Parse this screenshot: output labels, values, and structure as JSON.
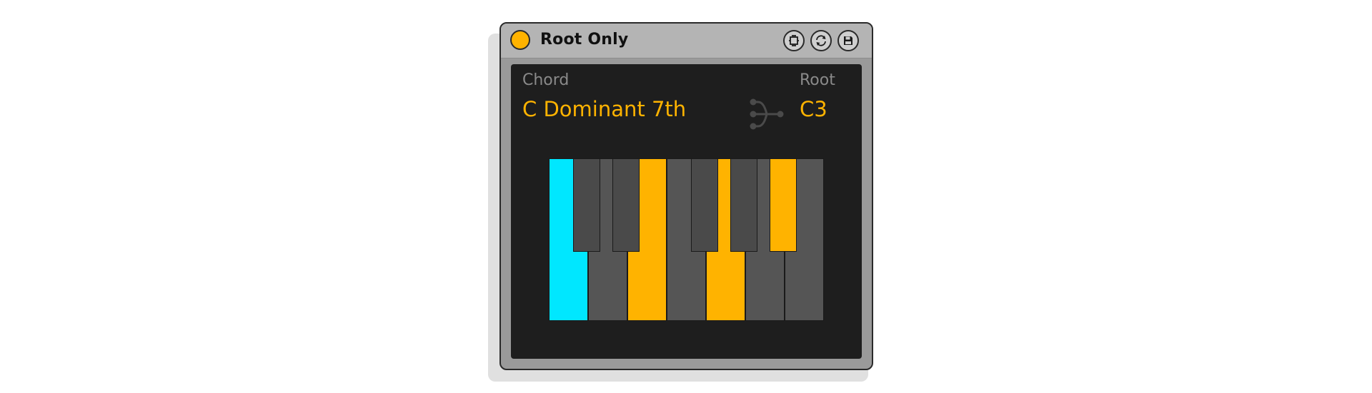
{
  "device": {
    "title": "Root Only",
    "power_on": true,
    "power_color": "#ffb300",
    "header_buttons": [
      {
        "icon": "hot-swap-icon"
      },
      {
        "icon": "refresh-icon"
      },
      {
        "icon": "save-preset-icon"
      }
    ]
  },
  "chord": {
    "label": "Chord",
    "value": "C Dominant 7th"
  },
  "root": {
    "label": "Root",
    "value": "C3"
  },
  "split_icon": "split-output-icon",
  "keyboard": {
    "white_keys": [
      {
        "note": "C",
        "state": "root"
      },
      {
        "note": "D",
        "state": "off"
      },
      {
        "note": "E",
        "state": "on"
      },
      {
        "note": "F",
        "state": "off"
      },
      {
        "note": "G",
        "state": "on"
      },
      {
        "note": "A",
        "state": "off"
      },
      {
        "note": "B",
        "state": "off"
      }
    ],
    "black_keys": [
      {
        "note": "C#",
        "state": "off"
      },
      {
        "note": "D#",
        "state": "off"
      },
      {
        "note": "F#",
        "state": "off"
      },
      {
        "note": "G#",
        "state": "off"
      },
      {
        "note": "A#",
        "state": "on"
      }
    ]
  },
  "colors": {
    "accent": "#ffb300",
    "root": "#00e7ff",
    "panel_bg": "#1e1e1e",
    "key_off": "#555555",
    "label": "#8a8a8a"
  }
}
